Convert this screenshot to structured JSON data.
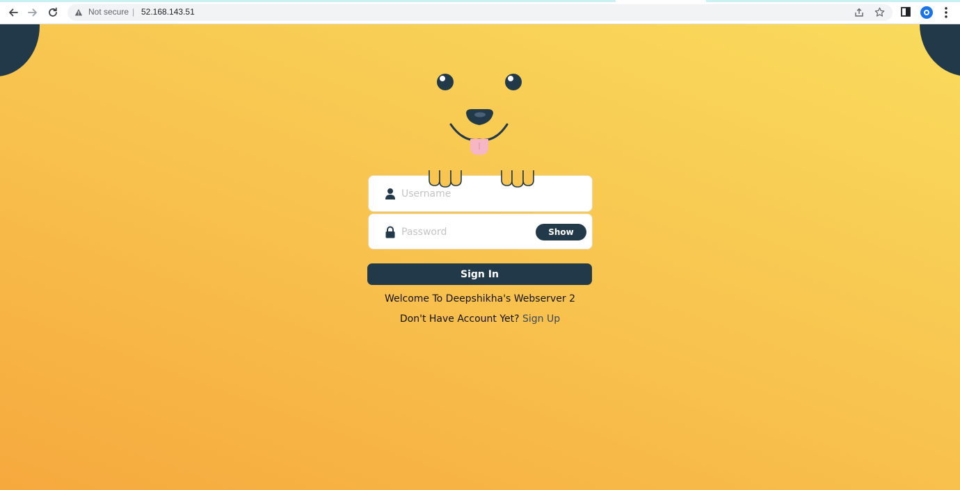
{
  "browser": {
    "security_label": "Not secure",
    "separator": "|",
    "url": "52.168.143.51",
    "icons": [
      "back-arrow-icon",
      "forward-arrow-icon",
      "reload-icon",
      "warning-icon",
      "share-icon",
      "star-icon",
      "side-panel-icon",
      "extension-icon",
      "kebab-menu-icon"
    ]
  },
  "login": {
    "username_placeholder": "Username",
    "password_placeholder": "Password",
    "show_label": "Show",
    "signin_label": "Sign In",
    "welcome_text": "Welcome To Deepshikha's Webserver 2",
    "no_account_text": "Don't Have Account Yet?",
    "signup_label": "Sign Up"
  },
  "theme": {
    "dark": "#22394a",
    "gradient_top": "#f9db5c",
    "gradient_bottom": "#f6a93e",
    "tongue": "#f7b6c6"
  }
}
